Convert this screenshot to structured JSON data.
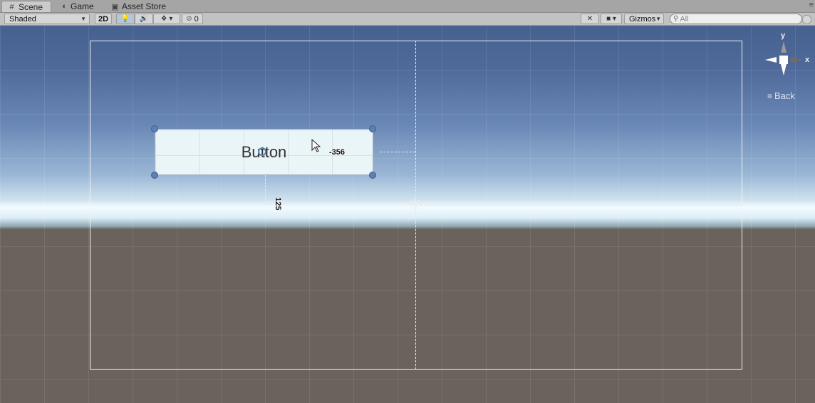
{
  "tabs": [
    {
      "label": "Scene",
      "icon": "grid-icon",
      "active": true
    },
    {
      "label": "Game",
      "icon": "pacman-icon",
      "active": false
    },
    {
      "label": "Asset Store",
      "icon": "bag-icon",
      "active": false
    }
  ],
  "toolbar": {
    "shading_mode": "Shaded",
    "mode_2d": "2D",
    "hidden_count": "0",
    "gizmos_label": "Gizmos",
    "search_value": "All"
  },
  "scene": {
    "button_text": "Button",
    "width_readout": "-356",
    "height_readout": "125",
    "axis_y": "y",
    "axis_x": "x",
    "back_label": "Back"
  },
  "colors": {
    "sky_top": "#46618f",
    "horizon": "#f4fbff",
    "ground": "#6b625b",
    "handle": "#5d7fb3"
  }
}
